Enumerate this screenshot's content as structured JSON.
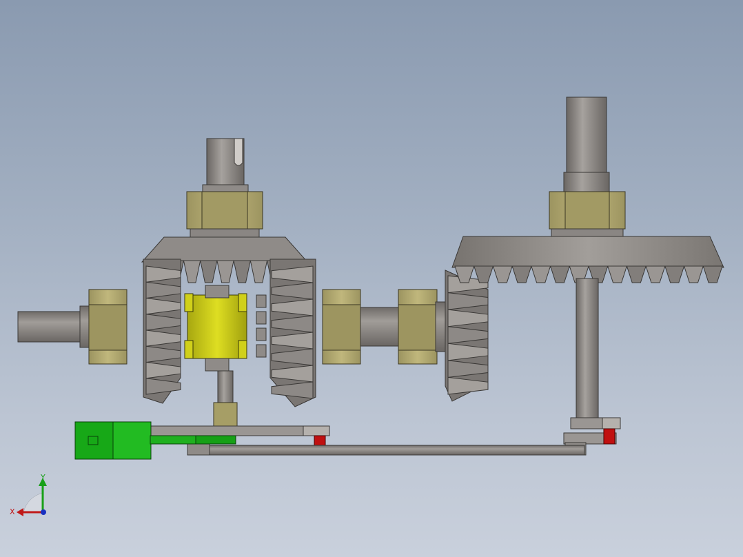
{
  "viewport": {
    "background_top": "#8a9ab0",
    "background_bottom": "#c9d0dc"
  },
  "model": {
    "parts": [
      "input-shaft",
      "differential-cage",
      "spider-gear",
      "left-side-bevel-gear",
      "right-side-bevel-gear",
      "output-shaft",
      "bevel-pinion",
      "crown-bevel-gear",
      "vertical-shaft",
      "hex-nut",
      "mounting-bracket",
      "linkage-rod",
      "lever-arm",
      "stop-block"
    ],
    "colors": {
      "steel": "#8f8b88",
      "steel_dark": "#5e5b59",
      "brass": "#b5ac72",
      "cage_yellow": "#d2d21c",
      "bracket_green": "#1aa81a",
      "stop_red": "#c01010"
    }
  },
  "triad": {
    "x_label": "X",
    "y_label": "Y",
    "x_color": "#c01818",
    "y_color": "#18a018",
    "z_color": "#1830c0"
  }
}
